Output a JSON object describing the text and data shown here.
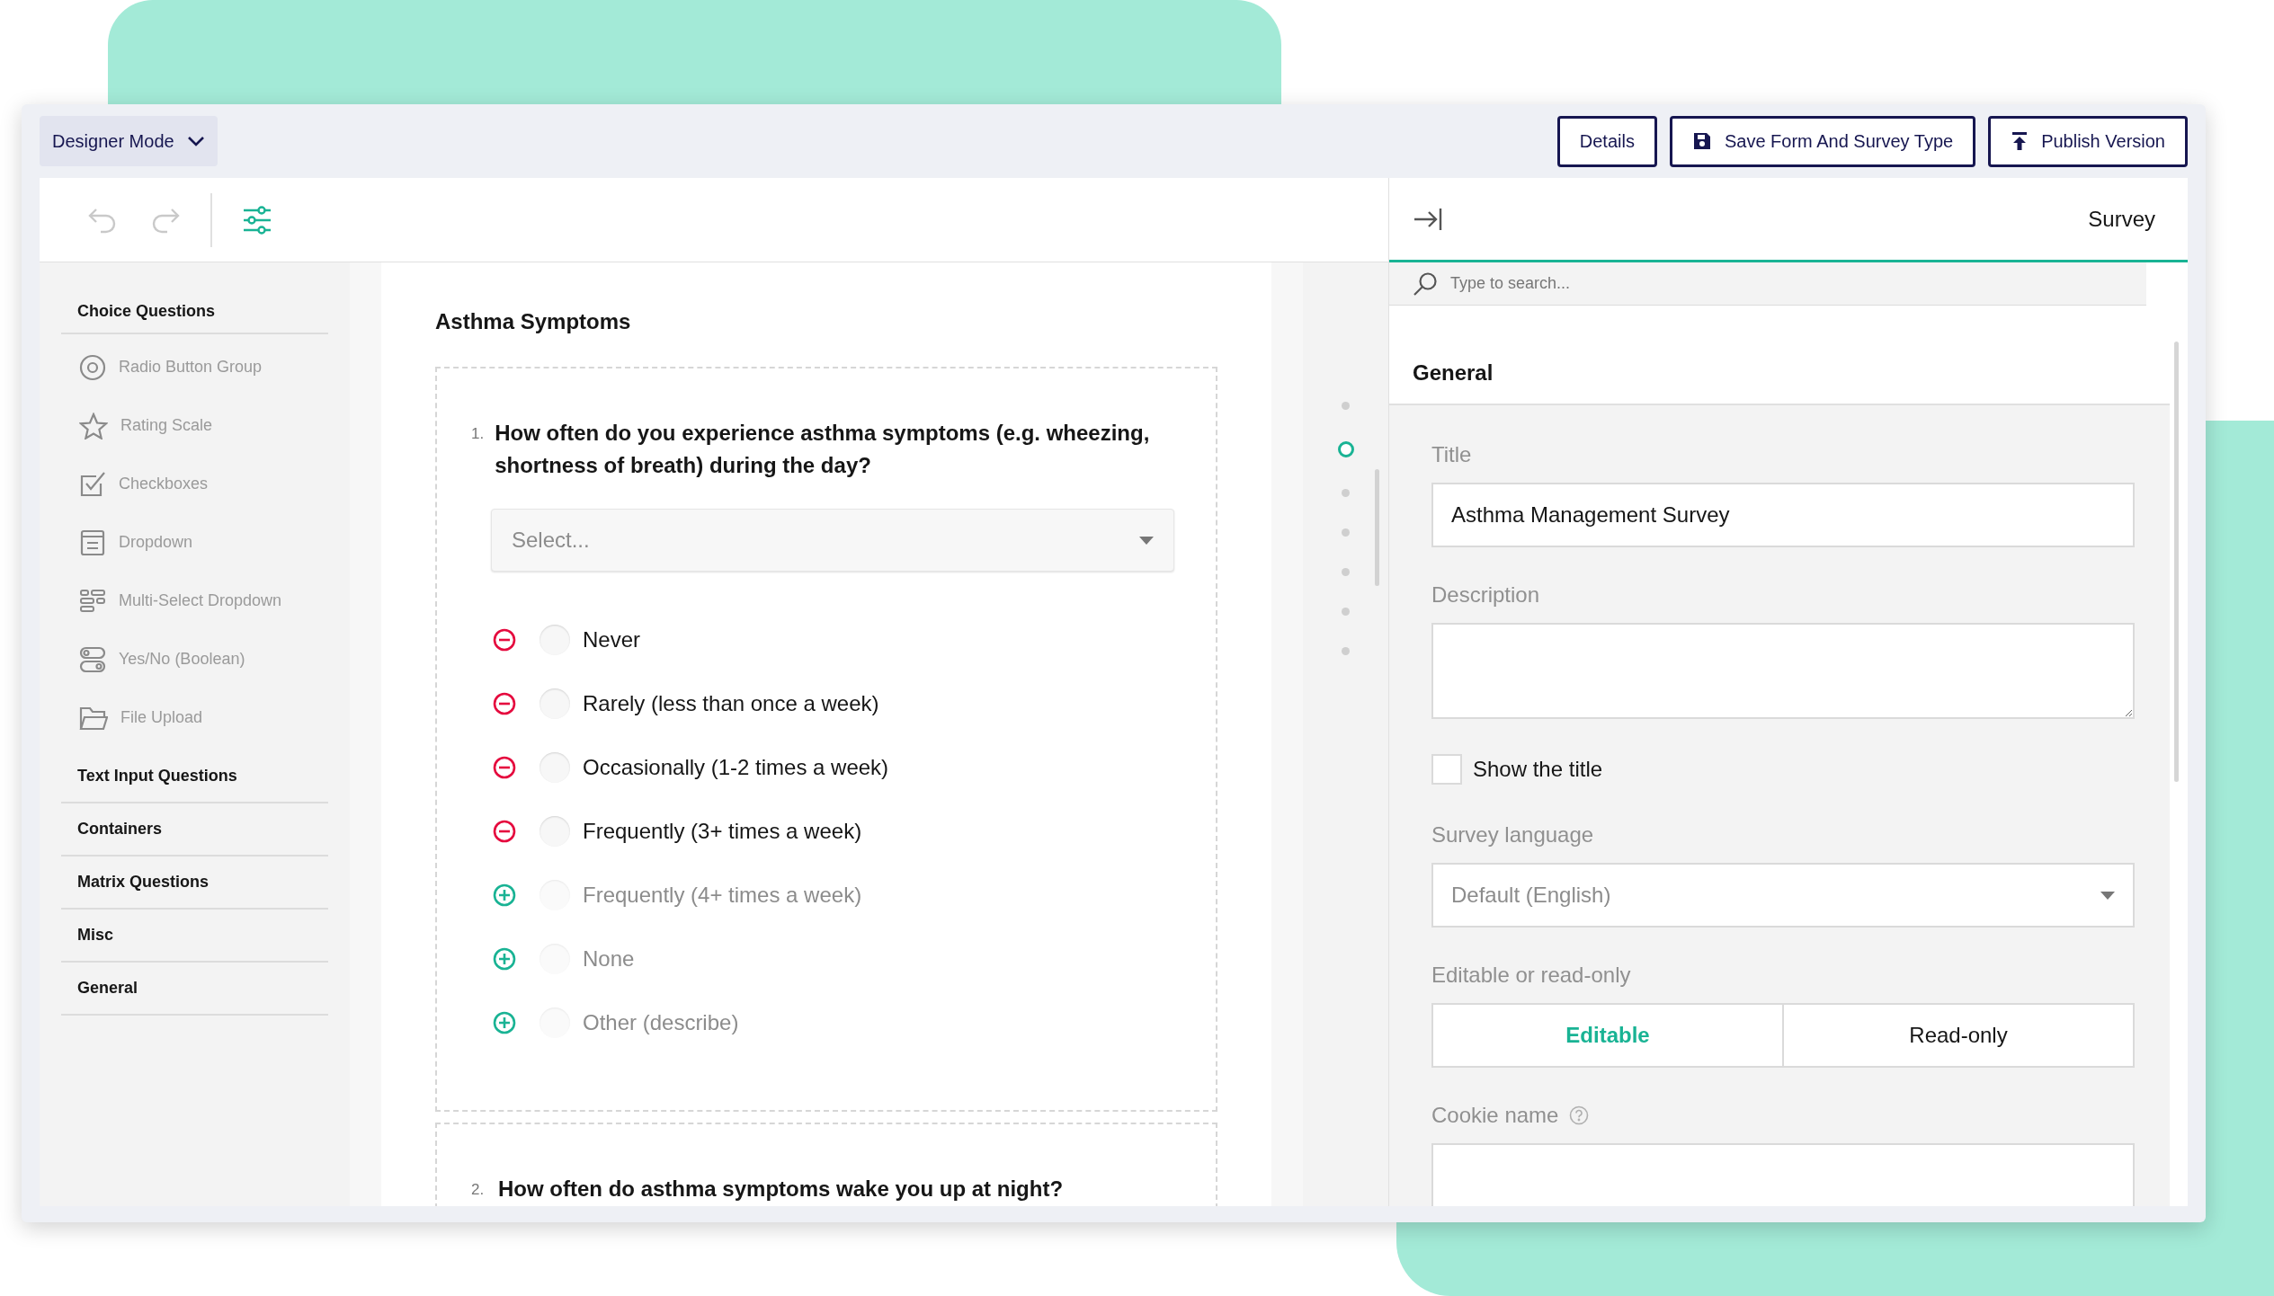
{
  "header": {
    "mode_menu": "Designer Mode",
    "buttons": [
      {
        "label": "Details",
        "kind": "plain"
      },
      {
        "label": "Save Form And Survey Type",
        "kind": "save"
      },
      {
        "label": "Publish Version",
        "kind": "publish"
      }
    ]
  },
  "toolbar": {
    "undo": {
      "disabled": true
    },
    "redo": {
      "disabled": true
    }
  },
  "sidebar": {
    "categories": [
      {
        "label": "Choice Questions",
        "expanded": true,
        "items": [
          {
            "label": "Radio Button Group",
            "kind": "radio"
          },
          {
            "label": "Rating Scale",
            "kind": "rating"
          },
          {
            "label": "Checkboxes",
            "kind": "checkbox"
          },
          {
            "label": "Dropdown",
            "kind": "dropdown"
          },
          {
            "label": "Multi-Select Dropdown",
            "kind": "multiselect"
          },
          {
            "label": "Yes/No (Boolean)",
            "kind": "boolean"
          },
          {
            "label": "File Upload",
            "kind": "file"
          }
        ]
      },
      {
        "label": "Text Input Questions",
        "expanded": false
      },
      {
        "label": "Containers",
        "expanded": false
      },
      {
        "label": "Matrix Questions",
        "expanded": false
      },
      {
        "label": "Misc",
        "expanded": false
      },
      {
        "label": "General",
        "expanded": false
      }
    ]
  },
  "canvas": {
    "page_title": "Asthma Symptoms",
    "questions": [
      {
        "number": "1.",
        "text": "How often do you experience asthma symptoms (e.g. wheezing, shortness of breath) during the day?",
        "placeholder": "Select...",
        "choices": [
          {
            "label": "Never",
            "added": true,
            "selected": false
          },
          {
            "label": "Rarely (less than once a week)",
            "added": true,
            "selected": false
          },
          {
            "label": "Occasionally (1-2 times a week)",
            "added": true,
            "selected": false
          },
          {
            "label": "Frequently (3+ times a week)",
            "added": true,
            "selected": false
          },
          {
            "label": "Frequently (4+ times a week)",
            "added": false,
            "selected": false
          },
          {
            "label": "None",
            "added": false,
            "selected": false
          },
          {
            "label": "Other (describe)",
            "added": false,
            "selected": false
          }
        ]
      },
      {
        "number": "2.",
        "text": "How often do asthma symptoms wake you up at night?"
      }
    ]
  },
  "page_nav": [
    {
      "selected": false
    },
    {
      "selected": true
    },
    {
      "selected": false
    },
    {
      "selected": false
    },
    {
      "selected": false
    },
    {
      "selected": false
    },
    {
      "selected": false
    }
  ],
  "property_panel": {
    "title": "Survey",
    "search": {
      "placeholder": "Type to search..."
    },
    "section": "General",
    "fields": [
      {
        "kind": "text",
        "label": "Title",
        "value": "Asthma Management Survey"
      },
      {
        "kind": "textarea",
        "label": "Description"
      },
      {
        "kind": "checkbox",
        "label": "Show the title",
        "checked": false
      },
      {
        "kind": "dropdown",
        "label": "Survey language",
        "value": "Default (English)"
      },
      {
        "kind": "segmented",
        "label": "Editable or read-only",
        "options": [
          {
            "label": "Editable",
            "selected": true
          },
          {
            "label": "Read-only",
            "selected": false
          }
        ]
      },
      {
        "kind": "text",
        "label": "Cookie name",
        "help": true
      }
    ]
  }
}
